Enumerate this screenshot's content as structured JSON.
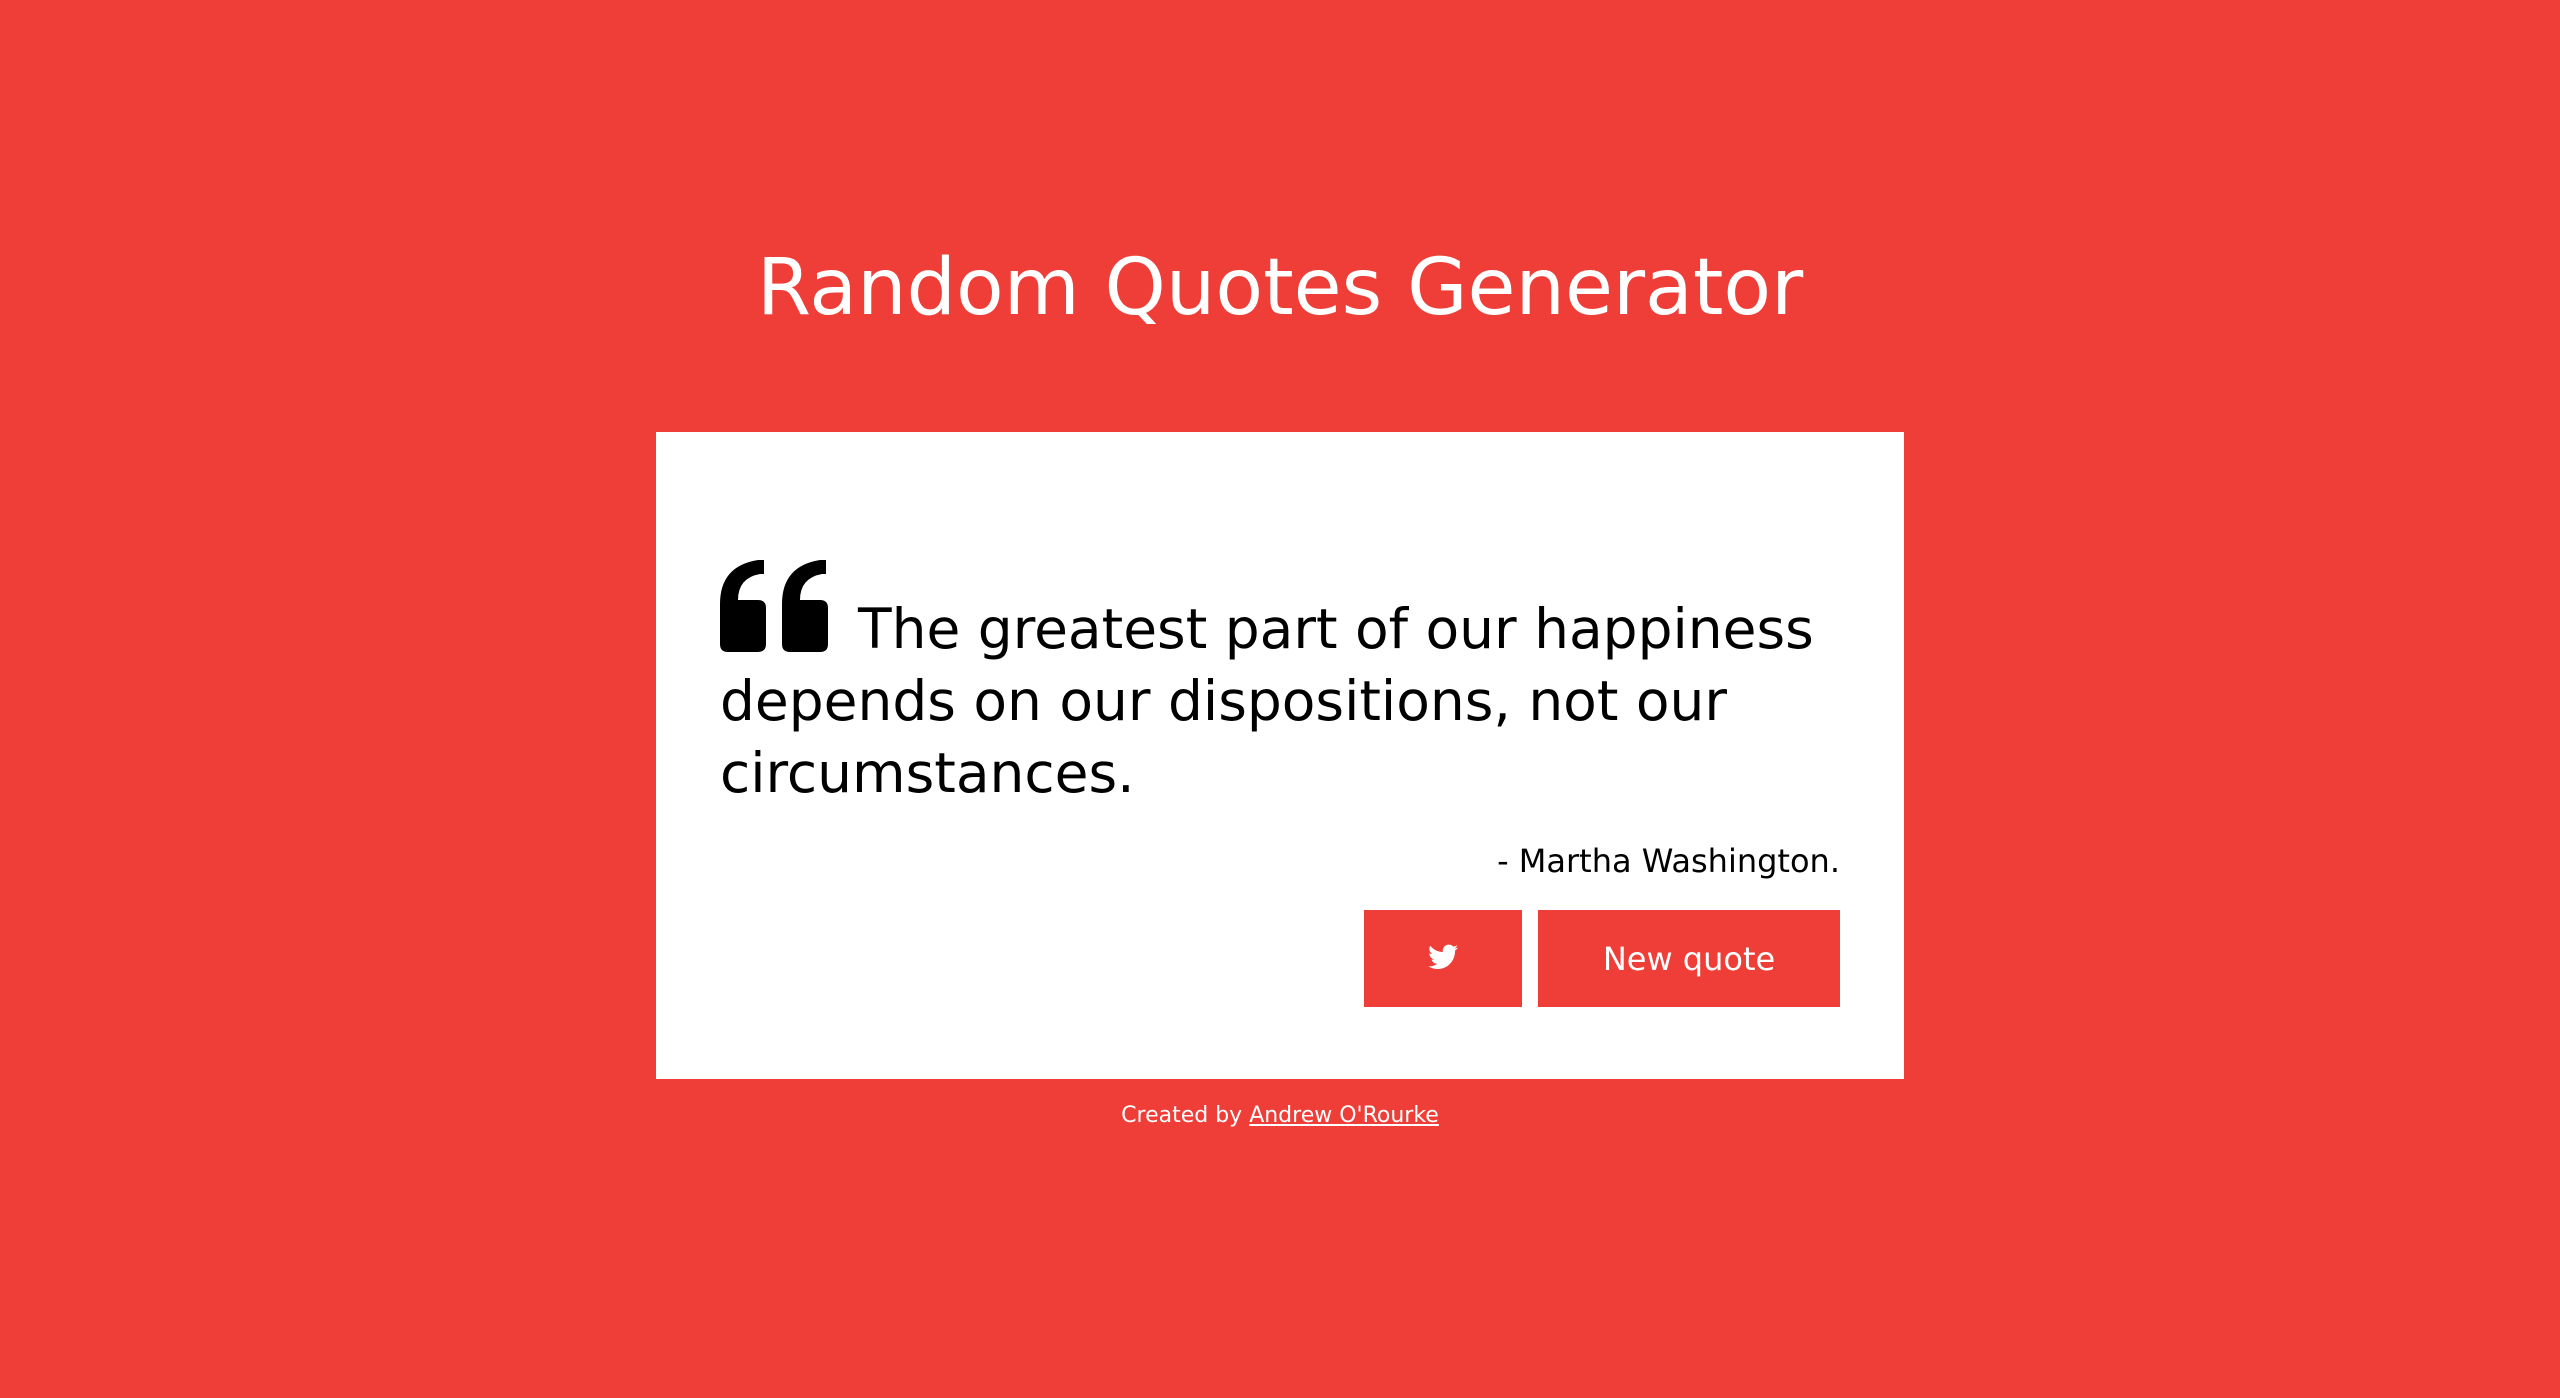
{
  "header": {
    "title": "Random Quotes Generator"
  },
  "quote": {
    "icon": "quote-left-icon",
    "text": "The greatest part of our happiness depends on our dispositions, not our circumstances.",
    "author": "- Martha Washington."
  },
  "actions": {
    "tweet_icon": "twitter-icon",
    "new_quote_label": "New quote"
  },
  "footer": {
    "created_by_label": "Created by",
    "author_link_text": "Andrew O'Rourke"
  },
  "colors": {
    "background": "#EF3E37",
    "card": "#FFFFFF",
    "text": "#000000",
    "button": "#EF3E37"
  }
}
